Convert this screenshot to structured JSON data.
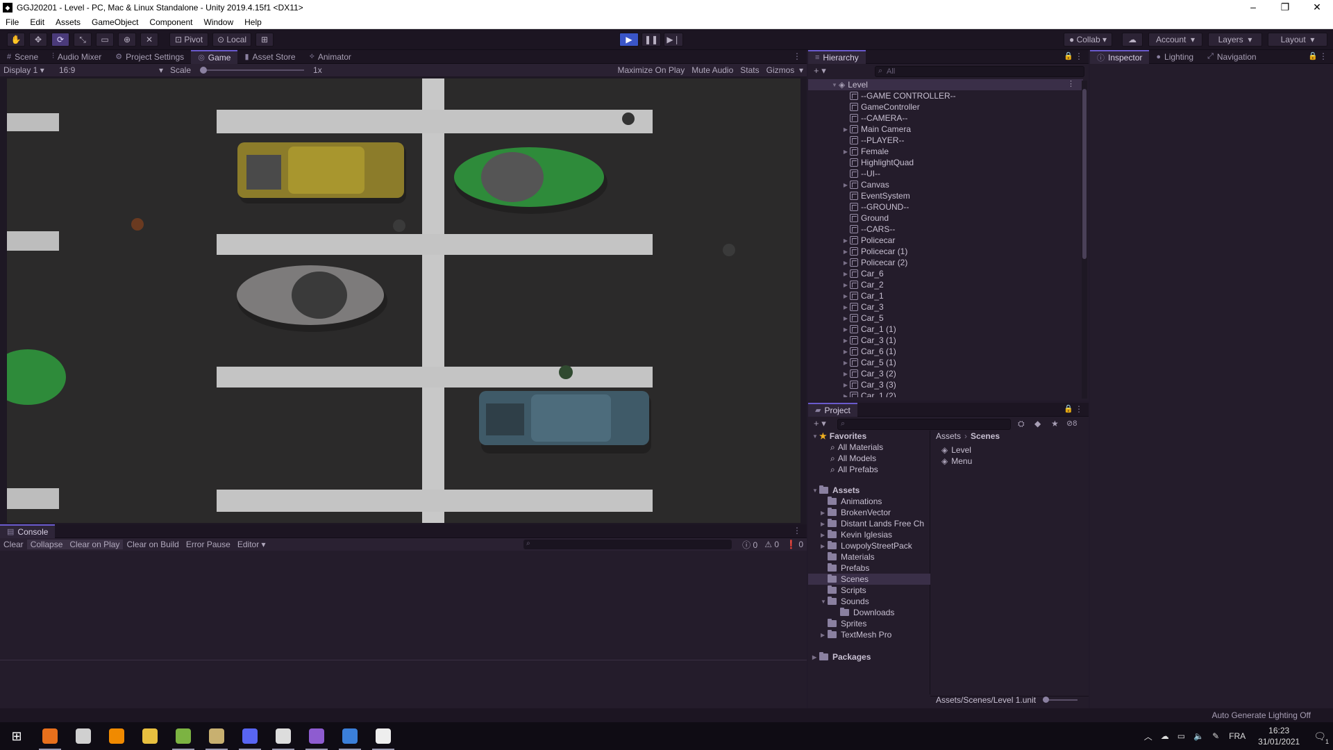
{
  "window": {
    "title": "GGJ20201 - Level - PC, Mac & Linux Standalone - Unity 2019.4.15f1 <DX11>",
    "controls": [
      "–",
      "❐",
      "✕"
    ]
  },
  "menu": [
    "File",
    "Edit",
    "Assets",
    "GameObject",
    "Component",
    "Window",
    "Help"
  ],
  "toolbar": {
    "pivot": "Pivot",
    "local": "Local",
    "collab": "Collab",
    "account": "Account",
    "layers": "Layers",
    "layout": "Layout"
  },
  "center_tabs": [
    {
      "label": "Scene",
      "icon": "#"
    },
    {
      "label": "Audio Mixer",
      "icon": "⫶"
    },
    {
      "label": "Project Settings",
      "icon": "⚙"
    },
    {
      "label": "Game",
      "icon": "◎"
    },
    {
      "label": "Asset Store",
      "icon": "▮"
    },
    {
      "label": "Animator",
      "icon": "⟡"
    }
  ],
  "game_bar": {
    "display": "Display 1",
    "aspect": "16:9",
    "scale_label": "Scale",
    "scale_value": "1x",
    "maximize": "Maximize On Play",
    "mute": "Mute Audio",
    "stats": "Stats",
    "gizmos": "Gizmos"
  },
  "hierarchy": {
    "tab": "Hierarchy",
    "search_placeholder": "All",
    "root": "Level",
    "items": [
      {
        "label": "--GAME CONTROLLER--",
        "expandable": false
      },
      {
        "label": "GameController",
        "expandable": false
      },
      {
        "label": "--CAMERA--",
        "expandable": false
      },
      {
        "label": "Main Camera",
        "expandable": true
      },
      {
        "label": "--PLAYER--",
        "expandable": false
      },
      {
        "label": "Female",
        "expandable": true
      },
      {
        "label": "HighlightQuad",
        "expandable": false
      },
      {
        "label": "--UI--",
        "expandable": false
      },
      {
        "label": "Canvas",
        "expandable": true
      },
      {
        "label": "EventSystem",
        "expandable": false
      },
      {
        "label": "--GROUND--",
        "expandable": false
      },
      {
        "label": "Ground",
        "expandable": false
      },
      {
        "label": "--CARS--",
        "expandable": false
      },
      {
        "label": "Policecar",
        "expandable": true
      },
      {
        "label": "Policecar (1)",
        "expandable": true
      },
      {
        "label": "Policecar (2)",
        "expandable": true
      },
      {
        "label": "Car_6",
        "expandable": true
      },
      {
        "label": "Car_2",
        "expandable": true
      },
      {
        "label": "Car_1",
        "expandable": true
      },
      {
        "label": "Car_3",
        "expandable": true
      },
      {
        "label": "Car_5",
        "expandable": true
      },
      {
        "label": "Car_1 (1)",
        "expandable": true
      },
      {
        "label": "Car_3 (1)",
        "expandable": true
      },
      {
        "label": "Car_6 (1)",
        "expandable": true
      },
      {
        "label": "Car_5 (1)",
        "expandable": true
      },
      {
        "label": "Car_3 (2)",
        "expandable": true
      },
      {
        "label": "Car_3 (3)",
        "expandable": true
      },
      {
        "label": "Car_1 (2)",
        "expandable": true
      }
    ]
  },
  "right_tabs": [
    {
      "label": "Inspector",
      "icon": "ⓘ"
    },
    {
      "label": "Lighting",
      "icon": "●"
    },
    {
      "label": "Navigation",
      "icon": "⤢"
    }
  ],
  "project": {
    "tab": "Project",
    "hidden_count": "8",
    "favorites_label": "Favorites",
    "favorites": [
      "All Materials",
      "All Models",
      "All Prefabs"
    ],
    "assets_label": "Assets",
    "folders": [
      {
        "label": "Animations",
        "expandable": false
      },
      {
        "label": "BrokenVector",
        "expandable": true
      },
      {
        "label": "Distant Lands Free Ch",
        "expandable": true
      },
      {
        "label": "Kevin Iglesias",
        "expandable": true
      },
      {
        "label": "LowpolyStreetPack",
        "expandable": true
      },
      {
        "label": "Materials",
        "expandable": false
      },
      {
        "label": "Prefabs",
        "expandable": false
      },
      {
        "label": "Scenes",
        "expandable": false,
        "selected": true
      },
      {
        "label": "Scripts",
        "expandable": false
      },
      {
        "label": "Sounds",
        "expandable": false,
        "open": true
      },
      {
        "label": "Downloads",
        "expandable": false,
        "child": true
      },
      {
        "label": "Sprites",
        "expandable": false
      },
      {
        "label": "TextMesh Pro",
        "expandable": true
      }
    ],
    "packages_label": "Packages",
    "breadcrumb": [
      "Assets",
      "Scenes"
    ],
    "files": [
      "Level",
      "Menu"
    ],
    "footer_path": "Assets/Scenes/Level 1.unit"
  },
  "console": {
    "tab": "Console",
    "buttons": [
      "Clear",
      "Collapse",
      "Clear on Play",
      "Clear on Build",
      "Error Pause",
      "Editor"
    ],
    "counts": [
      "0",
      "0",
      "0"
    ]
  },
  "status": {
    "right_text": "Auto Generate Lighting Off"
  },
  "taskbar": {
    "lang": "FRA",
    "time": "16:23",
    "date": "31/01/2021",
    "notifications": "1",
    "apps": [
      {
        "name": "firefox",
        "color": "#e8701c",
        "open": true
      },
      {
        "name": "foxhole",
        "color": "#d0d0d0",
        "open": false
      },
      {
        "name": "vlc",
        "color": "#f08a00",
        "open": false
      },
      {
        "name": "file-explorer",
        "color": "#e8c040",
        "open": false
      },
      {
        "name": "notepad-plus",
        "color": "#7cb342",
        "open": true
      },
      {
        "name": "archive",
        "color": "#c8b070",
        "open": true
      },
      {
        "name": "discord",
        "color": "#5865f2",
        "open": true
      },
      {
        "name": "unity",
        "color": "#dddddd",
        "open": true
      },
      {
        "name": "visual-studio",
        "color": "#8e5cd0",
        "open": true
      },
      {
        "name": "paint",
        "color": "#3b7fd9",
        "open": true
      },
      {
        "name": "7zip",
        "color": "#eeeeee",
        "open": true
      }
    ]
  },
  "colors": {
    "editor_bg": "#241c2b",
    "accent": "#6a5acd",
    "play_button": "#3a55c8"
  }
}
